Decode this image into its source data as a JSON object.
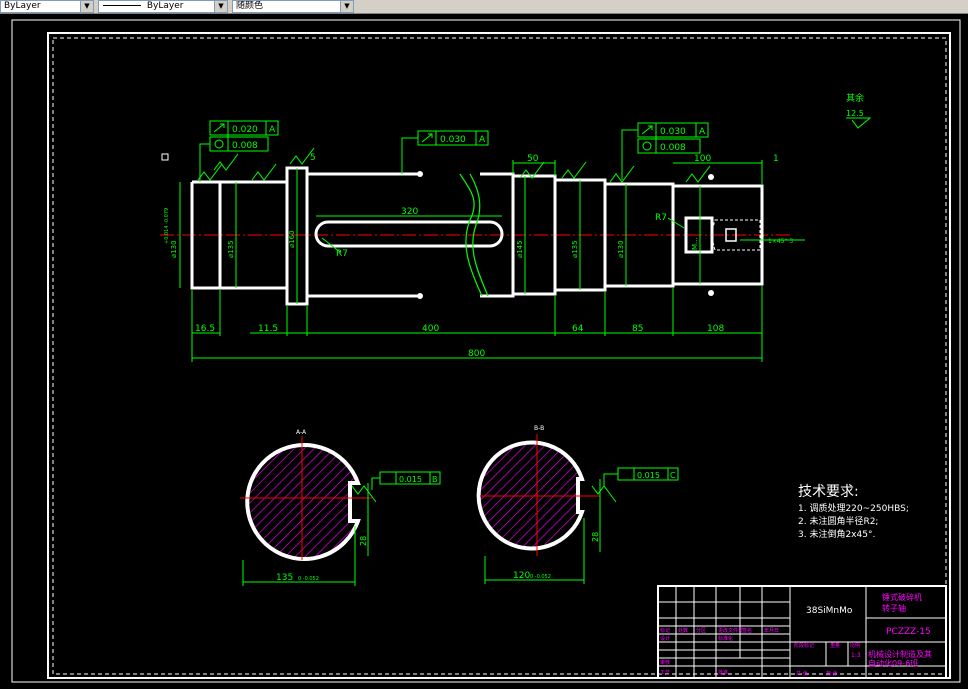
{
  "toolbar": {
    "layer_combo": "ByLayer",
    "linetype_combo": "ByLayer",
    "color_combo": "随颜色"
  },
  "surface_roughness_rest": {
    "label": "其余",
    "value": "12.5"
  },
  "gdt": {
    "left_runout": "0.020",
    "left_runout_datum": "A",
    "left_cyl": "0.008",
    "mid_runout": "0.030",
    "mid_runout_datum": "A",
    "right_runout": "0.030",
    "right_runout_datum": "A",
    "right_cyl": "0.008",
    "section_a_sym": "0.015",
    "section_a_datum": "B",
    "section_b_sym": "0.015",
    "section_b_datum": "C"
  },
  "dimensions": {
    "d_320": "320",
    "d_50": "50",
    "d_100": "100",
    "d_1": "1",
    "d_5": "5",
    "d_16_5": "16.5",
    "d_11_5": "11.5",
    "d_400": "400",
    "d_64": "64",
    "d_85": "85",
    "d_108": "108",
    "d_800": "800",
    "r7_left": "R7",
    "r7_right": "R7",
    "dia_130_left": "⌀130",
    "dia_130_left_tol": "+0.014 -0.079",
    "dia_135_left": "⌀135",
    "dia_160": "⌀160",
    "dia_145": "⌀145",
    "dia_135_right": "⌀135",
    "dia_130_right": "⌀130",
    "dia_thread": "M...",
    "sec_a_width": "135",
    "sec_a_tol": "0 -0.052",
    "sec_a_depth": "28",
    "sec_b_width": "120",
    "sec_b_tol": "0 -0.052",
    "sec_b_depth": "28",
    "thread_note": "1×45° 3"
  },
  "sections": {
    "a_label": "A-A",
    "b_label": "B-B"
  },
  "tech_requirements": {
    "title": "技术要求:",
    "items": [
      "1. 调质处理220~250HBS;",
      "2. 未注圆角半径R2;",
      "3. 未注倒角2x45°."
    ]
  },
  "title_block": {
    "material": "38SiMnMo",
    "part_name_line1": "锤式破碎机",
    "part_name_line2": "转子轴",
    "drawing_no": "PCZZZ-15",
    "school_line1": "机械设计制造及其",
    "school_line2": "自动化09-6班",
    "scale": "1:3",
    "row_labels": [
      "标记",
      "处数",
      "分区",
      "更改文件号",
      "签名",
      "年月日"
    ],
    "sign_labels": [
      "设计",
      "标准化",
      "审核",
      "工艺",
      "批准"
    ],
    "stage_labels": [
      "阶段标记",
      "重量",
      "比例"
    ],
    "sheet_labels": [
      "共 张",
      "第 张"
    ]
  },
  "colors": {
    "background": "#000000",
    "outline": "#ffffff",
    "dimension": "#00ff00",
    "centerline": "#ff0000",
    "hatch": "#ff00ff",
    "frame": "#ffffff",
    "titleblock_text": "#ff00ff"
  }
}
